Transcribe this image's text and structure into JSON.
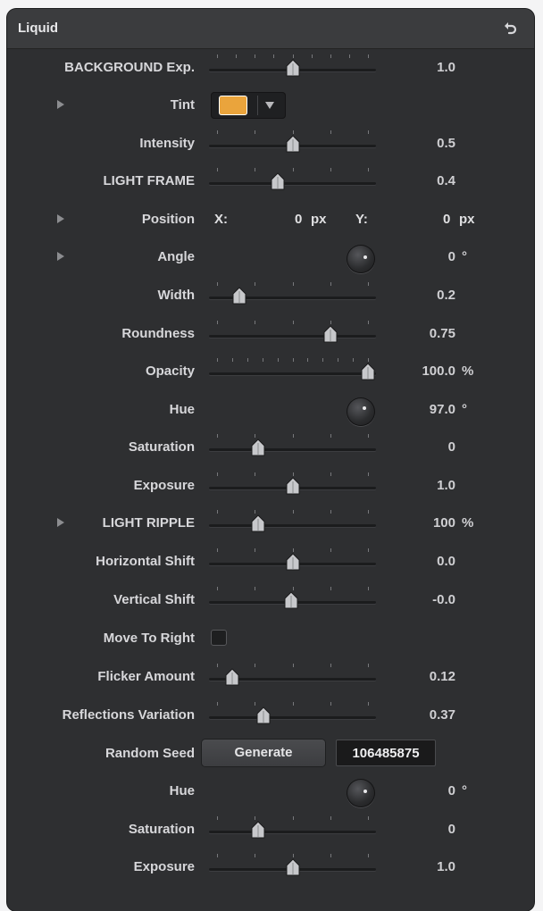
{
  "panel": {
    "title": "Liquid",
    "reset_icon": "reset-arrow-icon"
  },
  "rows": {
    "background_exp": {
      "label": "BACKGROUND Exp.",
      "value": "1.0",
      "level": 0.5
    },
    "tint": {
      "label": "Tint",
      "color": "#eaa43c"
    },
    "intensity": {
      "label": "Intensity",
      "value": "0.5",
      "level": 0.5
    },
    "light_frame": {
      "label": "LIGHT FRAME",
      "value": "0.4",
      "level": 0.4
    },
    "position": {
      "label": "Position",
      "x_label": "X:",
      "x_value": "0",
      "x_unit": "px",
      "y_label": "Y:",
      "y_value": "0",
      "y_unit": "px"
    },
    "angle": {
      "label": "Angle",
      "value": "0",
      "unit": "°"
    },
    "width": {
      "label": "Width",
      "value": "0.2",
      "level": 0.15
    },
    "roundness": {
      "label": "Roundness",
      "value": "0.75",
      "level": 0.75
    },
    "opacity": {
      "label": "Opacity",
      "value": "100.0",
      "unit": "%",
      "level": 1.0
    },
    "hue": {
      "label": "Hue",
      "value": "97.0",
      "unit": "°"
    },
    "saturation": {
      "label": "Saturation",
      "value": "0",
      "level": 0.27
    },
    "exposure": {
      "label": "Exposure",
      "value": "1.0",
      "level": 0.5
    },
    "light_ripple": {
      "label": "LIGHT RIPPLE",
      "value": "100",
      "unit": "%",
      "level": 0.27
    },
    "horizontal_shift": {
      "label": "Horizontal Shift",
      "value": "0.0",
      "level": 0.5
    },
    "vertical_shift": {
      "label": "Vertical Shift",
      "value": "-0.0",
      "level": 0.49
    },
    "move_to_right": {
      "label": "Move To Right",
      "checked": false
    },
    "flicker_amount": {
      "label": "Flicker Amount",
      "value": "0.12",
      "level": 0.1
    },
    "reflections_variation": {
      "label": "Reflections Variation",
      "value": "0.37",
      "level": 0.31
    },
    "random_seed": {
      "label": "Random Seed",
      "button": "Generate",
      "seed": "106485875"
    },
    "hue2": {
      "label": "Hue",
      "value": "0",
      "unit": "°"
    },
    "saturation2": {
      "label": "Saturation",
      "value": "0",
      "level": 0.27
    },
    "exposure2": {
      "label": "Exposure",
      "value": "1.0",
      "level": 0.5
    }
  }
}
